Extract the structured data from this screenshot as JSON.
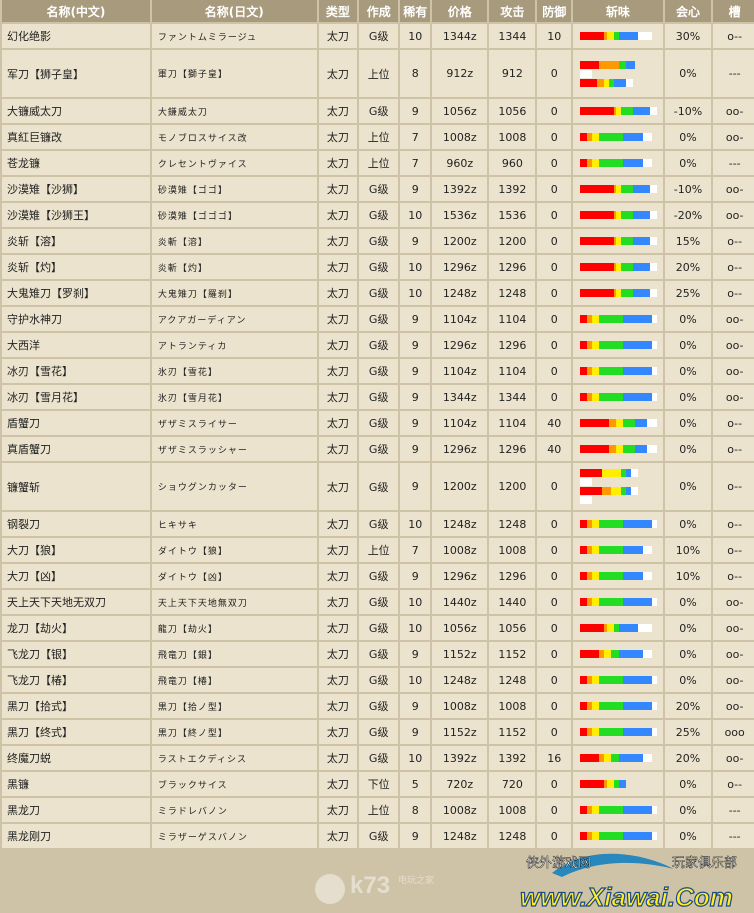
{
  "headers": [
    "名称(中文)",
    "名称(日文)",
    "类型",
    "作成",
    "稀有",
    "价格",
    "攻击",
    "防御",
    "斩味",
    "会心",
    "槽"
  ],
  "colors": {
    "red": "#ff0000",
    "orange": "#ff9900",
    "yellow": "#ffee00",
    "green": "#22dd22",
    "blue": "#3388ff",
    "white": "#ffffff"
  },
  "rows": [
    {
      "cn": "幻化绝影",
      "jp": "ファントムミラージュ",
      "type": "太刀",
      "craft": "G级",
      "rarity": "10",
      "price": "1344z",
      "attack": "1344",
      "defense": "10",
      "crit": "30%",
      "slots": "o--",
      "sharp": [
        [
          10,
          1,
          3,
          2,
          8,
          6
        ]
      ]
    },
    {
      "cn": "军刀【狮子皇】",
      "jp": "軍刀【獅子皇】",
      "type": "太刀",
      "craft": "上位",
      "rarity": "8",
      "price": "912z",
      "attack": "912",
      "defense": "0",
      "crit": "0%",
      "slots": "---",
      "sharp": [
        [
          8,
          8,
          0,
          3,
          4,
          0
        ],
        [
          0,
          0,
          0,
          0,
          0,
          5
        ],
        [
          7,
          3,
          2,
          2,
          5,
          3
        ]
      ]
    },
    {
      "cn": "大镰威太刀",
      "jp": "大鎌威太刀",
      "type": "太刀",
      "craft": "G级",
      "rarity": "9",
      "price": "1056z",
      "attack": "1056",
      "defense": "0",
      "crit": "-10%",
      "slots": "oo-",
      "sharp": [
        [
          14,
          1,
          2,
          5,
          7,
          3
        ]
      ]
    },
    {
      "cn": "真紅巨镰改",
      "jp": "モノブロスサイス改",
      "type": "太刀",
      "craft": "上位",
      "rarity": "7",
      "price": "1008z",
      "attack": "1008",
      "defense": "0",
      "crit": "0%",
      "slots": "oo-",
      "sharp": [
        [
          3,
          2,
          3,
          10,
          8,
          4
        ]
      ]
    },
    {
      "cn": "苍龙镰",
      "jp": "クレセントヴァイス",
      "type": "太刀",
      "craft": "上位",
      "rarity": "7",
      "price": "960z",
      "attack": "960",
      "defense": "0",
      "crit": "0%",
      "slots": "---",
      "sharp": [
        [
          3,
          2,
          3,
          10,
          8,
          4
        ]
      ]
    },
    {
      "cn": "沙漠雉【沙狮】",
      "jp": "砂漠雉【ゴゴ】",
      "type": "太刀",
      "craft": "G级",
      "rarity": "9",
      "price": "1392z",
      "attack": "1392",
      "defense": "0",
      "crit": "-10%",
      "slots": "oo-",
      "sharp": [
        [
          14,
          1,
          2,
          5,
          7,
          3
        ]
      ]
    },
    {
      "cn": "沙漠雉【沙狮王】",
      "jp": "砂漠雉【ゴゴゴ】",
      "type": "太刀",
      "craft": "G级",
      "rarity": "10",
      "price": "1536z",
      "attack": "1536",
      "defense": "0",
      "crit": "-20%",
      "slots": "oo-",
      "sharp": [
        [
          14,
          1,
          2,
          5,
          7,
          3
        ]
      ]
    },
    {
      "cn": "炎斩【溶】",
      "jp": "炎斬【溶】",
      "type": "太刀",
      "craft": "G级",
      "rarity": "9",
      "price": "1200z",
      "attack": "1200",
      "defense": "0",
      "crit": "15%",
      "slots": "o--",
      "sharp": [
        [
          14,
          1,
          2,
          5,
          7,
          3
        ]
      ]
    },
    {
      "cn": "炎斩【灼】",
      "jp": "炎斬【灼】",
      "type": "太刀",
      "craft": "G级",
      "rarity": "10",
      "price": "1296z",
      "attack": "1296",
      "defense": "0",
      "crit": "20%",
      "slots": "o--",
      "sharp": [
        [
          14,
          1,
          2,
          5,
          7,
          3
        ]
      ]
    },
    {
      "cn": "大鬼雉刀【罗刹】",
      "jp": "大鬼雉刀【羅刹】",
      "type": "太刀",
      "craft": "G级",
      "rarity": "10",
      "price": "1248z",
      "attack": "1248",
      "defense": "0",
      "crit": "25%",
      "slots": "o--",
      "sharp": [
        [
          14,
          1,
          2,
          5,
          7,
          3
        ]
      ]
    },
    {
      "cn": "守护水神刀",
      "jp": "アクアガーディアン",
      "type": "太刀",
      "craft": "G级",
      "rarity": "9",
      "price": "1104z",
      "attack": "1104",
      "defense": "0",
      "crit": "0%",
      "slots": "oo-",
      "sharp": [
        [
          3,
          2,
          3,
          10,
          12,
          2
        ]
      ]
    },
    {
      "cn": "大西洋",
      "jp": "アトランティカ",
      "type": "太刀",
      "craft": "G级",
      "rarity": "9",
      "price": "1296z",
      "attack": "1296",
      "defense": "0",
      "crit": "0%",
      "slots": "oo-",
      "sharp": [
        [
          3,
          2,
          3,
          10,
          12,
          2
        ]
      ]
    },
    {
      "cn": "冰刃【雪花】",
      "jp": "氷刃【雪花】",
      "type": "太刀",
      "craft": "G级",
      "rarity": "9",
      "price": "1104z",
      "attack": "1104",
      "defense": "0",
      "crit": "0%",
      "slots": "oo-",
      "sharp": [
        [
          3,
          2,
          3,
          10,
          12,
          2
        ]
      ]
    },
    {
      "cn": "冰刃【雪月花】",
      "jp": "氷刃【雪月花】",
      "type": "太刀",
      "craft": "G级",
      "rarity": "9",
      "price": "1344z",
      "attack": "1344",
      "defense": "0",
      "crit": "0%",
      "slots": "oo-",
      "sharp": [
        [
          3,
          2,
          3,
          10,
          12,
          2
        ]
      ]
    },
    {
      "cn": "盾蟹刀",
      "jp": "ザザミスライサー",
      "type": "太刀",
      "craft": "G级",
      "rarity": "9",
      "price": "1104z",
      "attack": "1104",
      "defense": "40",
      "crit": "0%",
      "slots": "o--",
      "sharp": [
        [
          12,
          3,
          3,
          5,
          5,
          4
        ]
      ]
    },
    {
      "cn": "真盾蟹刀",
      "jp": "ザザミスラッシャー",
      "type": "太刀",
      "craft": "G级",
      "rarity": "9",
      "price": "1296z",
      "attack": "1296",
      "defense": "40",
      "crit": "0%",
      "slots": "o--",
      "sharp": [
        [
          12,
          3,
          3,
          5,
          5,
          4
        ]
      ]
    },
    {
      "cn": "镰蟹斩",
      "jp": "ショウグンカッター",
      "type": "太刀",
      "craft": "G级",
      "rarity": "9",
      "price": "1200z",
      "attack": "1200",
      "defense": "0",
      "crit": "0%",
      "slots": "o--",
      "sharp": [
        [
          9,
          0,
          8,
          2,
          2,
          3
        ],
        [
          0,
          0,
          0,
          0,
          0,
          5
        ],
        [
          9,
          4,
          4,
          2,
          2,
          3
        ],
        [
          0,
          0,
          0,
          0,
          0,
          5
        ]
      ]
    },
    {
      "cn": "钢裂刀",
      "jp": "ヒキサキ",
      "type": "太刀",
      "craft": "G级",
      "rarity": "10",
      "price": "1248z",
      "attack": "1248",
      "defense": "0",
      "crit": "0%",
      "slots": "o--",
      "sharp": [
        [
          3,
          2,
          3,
          10,
          12,
          2
        ]
      ]
    },
    {
      "cn": "大刀【狼】",
      "jp": "ダイトウ【狼】",
      "type": "太刀",
      "craft": "上位",
      "rarity": "7",
      "price": "1008z",
      "attack": "1008",
      "defense": "0",
      "crit": "10%",
      "slots": "o--",
      "sharp": [
        [
          3,
          2,
          3,
          10,
          8,
          4
        ]
      ]
    },
    {
      "cn": "大刀【凶】",
      "jp": "ダイトウ【凶】",
      "type": "太刀",
      "craft": "G级",
      "rarity": "9",
      "price": "1296z",
      "attack": "1296",
      "defense": "0",
      "crit": "10%",
      "slots": "o--",
      "sharp": [
        [
          3,
          2,
          3,
          10,
          8,
          4
        ]
      ]
    },
    {
      "cn": "天上天下天地无双刀",
      "jp": "天上天下天地無双刀",
      "type": "太刀",
      "craft": "G级",
      "rarity": "10",
      "price": "1440z",
      "attack": "1440",
      "defense": "0",
      "crit": "0%",
      "slots": "oo-",
      "sharp": [
        [
          3,
          2,
          3,
          10,
          12,
          2
        ]
      ]
    },
    {
      "cn": "龙刀【劫火】",
      "jp": "龍刀【劫火】",
      "type": "太刀",
      "craft": "G级",
      "rarity": "10",
      "price": "1056z",
      "attack": "1056",
      "defense": "0",
      "crit": "0%",
      "slots": "oo-",
      "sharp": [
        [
          10,
          1,
          3,
          2,
          8,
          6
        ]
      ]
    },
    {
      "cn": "飞龙刀【银】",
      "jp": "飛竜刀【銀】",
      "type": "太刀",
      "craft": "G级",
      "rarity": "9",
      "price": "1152z",
      "attack": "1152",
      "defense": "0",
      "crit": "0%",
      "slots": "oo-",
      "sharp": [
        [
          8,
          2,
          3,
          3,
          10,
          4
        ]
      ]
    },
    {
      "cn": "飞龙刀【椿】",
      "jp": "飛竜刀【椿】",
      "type": "太刀",
      "craft": "G级",
      "rarity": "10",
      "price": "1248z",
      "attack": "1248",
      "defense": "0",
      "crit": "0%",
      "slots": "oo-",
      "sharp": [
        [
          3,
          2,
          3,
          10,
          12,
          2
        ]
      ]
    },
    {
      "cn": "黑刀【拾式】",
      "jp": "黒刀【拾ノ型】",
      "type": "太刀",
      "craft": "G级",
      "rarity": "9",
      "price": "1008z",
      "attack": "1008",
      "defense": "0",
      "crit": "20%",
      "slots": "oo-",
      "sharp": [
        [
          3,
          2,
          3,
          10,
          12,
          2
        ]
      ]
    },
    {
      "cn": "黑刀【终式】",
      "jp": "黒刀【終ノ型】",
      "type": "太刀",
      "craft": "G级",
      "rarity": "9",
      "price": "1152z",
      "attack": "1152",
      "defense": "0",
      "crit": "25%",
      "slots": "ooo",
      "sharp": [
        [
          3,
          2,
          3,
          10,
          12,
          2
        ]
      ]
    },
    {
      "cn": "终魔刀蜕",
      "jp": "ラストエクディシス",
      "type": "太刀",
      "craft": "G级",
      "rarity": "10",
      "price": "1392z",
      "attack": "1392",
      "defense": "16",
      "crit": "20%",
      "slots": "oo-",
      "sharp": [
        [
          8,
          2,
          3,
          3,
          10,
          4
        ]
      ]
    },
    {
      "cn": "黑镰",
      "jp": "ブラックサイス",
      "type": "太刀",
      "craft": "下位",
      "rarity": "5",
      "price": "720z",
      "attack": "720",
      "defense": "0",
      "crit": "0%",
      "slots": "o--",
      "sharp": [
        [
          10,
          1,
          3,
          2,
          3,
          0
        ]
      ]
    },
    {
      "cn": "黑龙刀",
      "jp": "ミラドレバノン",
      "type": "太刀",
      "craft": "上位",
      "rarity": "8",
      "price": "1008z",
      "attack": "1008",
      "defense": "0",
      "crit": "0%",
      "slots": "---",
      "sharp": [
        [
          3,
          2,
          3,
          10,
          12,
          2
        ]
      ]
    },
    {
      "cn": "黑龙刚刀",
      "jp": "ミラザーゲスバノン",
      "type": "太刀",
      "craft": "G级",
      "rarity": "9",
      "price": "1248z",
      "attack": "1248",
      "defense": "0",
      "crit": "0%",
      "slots": "---",
      "sharp": [
        [
          3,
          2,
          3,
          10,
          12,
          2
        ]
      ]
    }
  ],
  "watermark": {
    "site1": "k73",
    "site1_sub": "电玩之家",
    "site2_top": "侠外游戏网",
    "site2_right": "玩家俱乐部",
    "site2_main": "www.Xiawai.Com"
  }
}
